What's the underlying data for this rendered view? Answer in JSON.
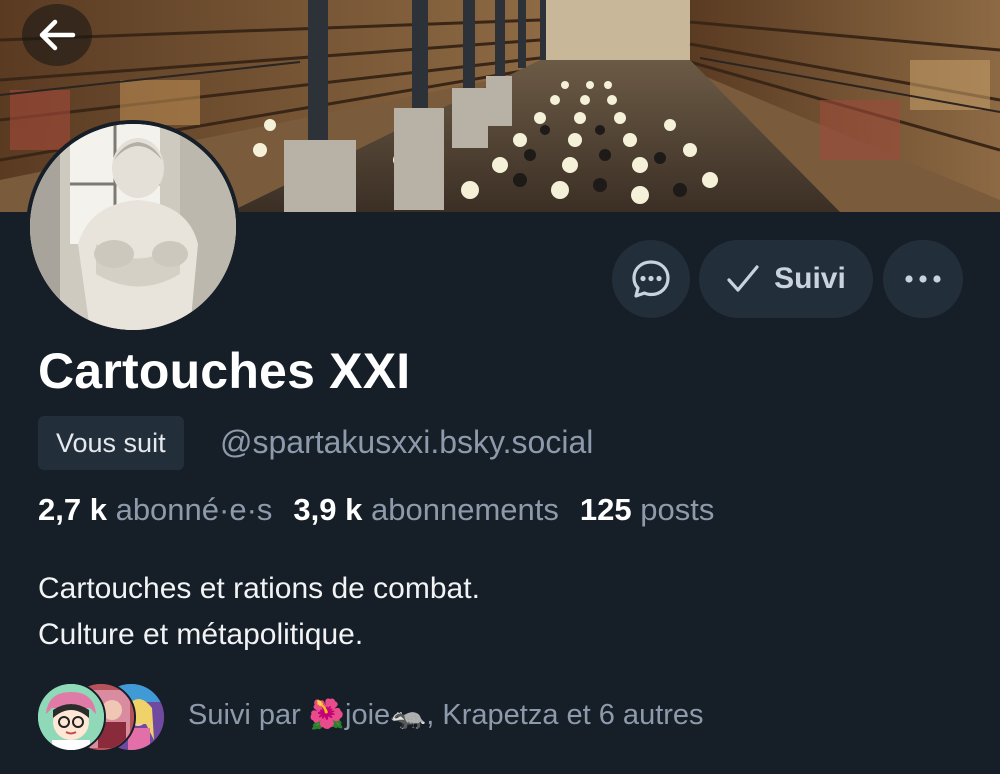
{
  "banner": {
    "image": "library-reading-room-photo"
  },
  "nav": {
    "back_icon": "arrow-left-icon"
  },
  "profile": {
    "display_name": "Cartouches XXI",
    "follows_you_badge": "Vous suit",
    "handle": "@spartakusxxi.bsky.social",
    "avatar": "classical-statue-avatar"
  },
  "actions": {
    "message_icon": "chat-bubble-icon",
    "follow_label": "Suivi",
    "follow_icon": "checkmark-icon",
    "more_icon": "ellipsis-icon"
  },
  "stats": {
    "followers_value": "2,7 k",
    "followers_label": "abonné·e·s",
    "following_value": "3,9 k",
    "following_label": "abonnements",
    "posts_value": "125",
    "posts_label": "posts"
  },
  "bio": {
    "line1": "Cartouches et rations de combat.",
    "line2": "Culture et métapolitique."
  },
  "followed_by": {
    "prefix": "Suivi par ",
    "emoji_flower": "🌺",
    "name1": "joie",
    "emoji_animal": "🦡",
    "rest": ", Krapetza et 6 autres"
  },
  "colors": {
    "background": "#161e27",
    "button_bg": "#232e3b",
    "muted_text": "#8d9aab",
    "primary_text": "#ffffff"
  }
}
